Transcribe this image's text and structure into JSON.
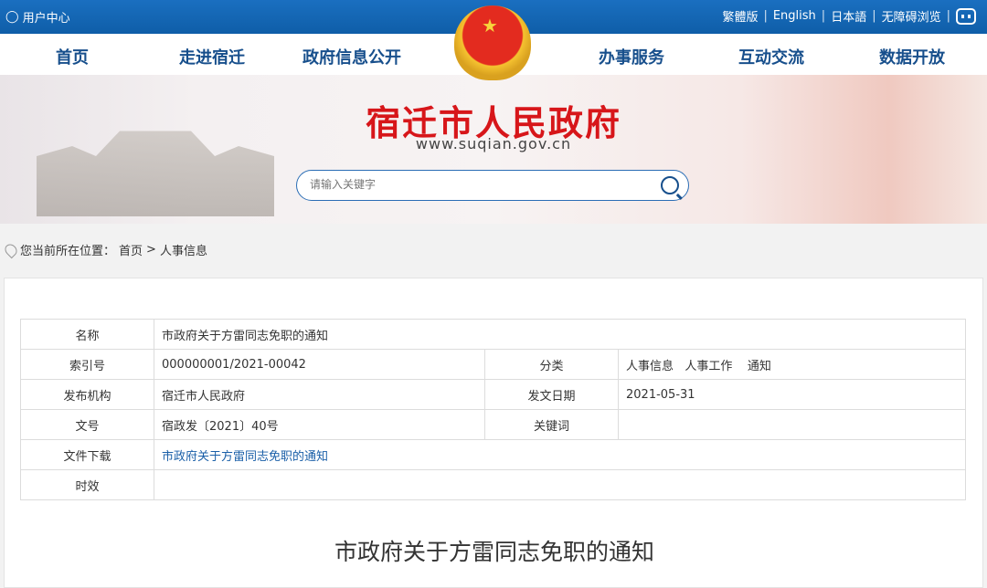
{
  "topbar": {
    "user_center": "用户中心",
    "langs": [
      "繁體版",
      "English",
      "日本語",
      "无障碍浏览"
    ],
    "separator": "|"
  },
  "nav": [
    "首页",
    "走进宿迁",
    "政府信息公开",
    "办事服务",
    "互动交流",
    "数据开放"
  ],
  "banner": {
    "title": "宿迁市人民政府",
    "url": "www.suqian.gov.cn",
    "search_placeholder": "请输入关键字"
  },
  "breadcrumb": {
    "prefix": "您当前所在位置：",
    "items": [
      "首页",
      "人事信息"
    ],
    "sep": ">"
  },
  "meta": {
    "name_label": "名称",
    "name": "市政府关于方雷同志免职的通知",
    "index_label": "索引号",
    "index": "000000001/2021-00042",
    "category_label": "分类",
    "category": "人事信息   人事工作    通知",
    "org_label": "发布机构",
    "org": "宿迁市人民政府",
    "date_label": "发文日期",
    "date": "2021-05-31",
    "docno_label": "文号",
    "docno": "宿政发〔2021〕40号",
    "keywords_label": "关键词",
    "keywords": "",
    "download_label": "文件下载",
    "download": "市政府关于方雷同志免职的通知",
    "validity_label": "时效",
    "validity": ""
  },
  "article": {
    "title": "市政府关于方雷同志免职的通知"
  },
  "colors": {
    "topbar": "#1565b5",
    "nav_text": "#174f8c",
    "title_red": "#d7161a",
    "link": "#1a5fa8"
  }
}
